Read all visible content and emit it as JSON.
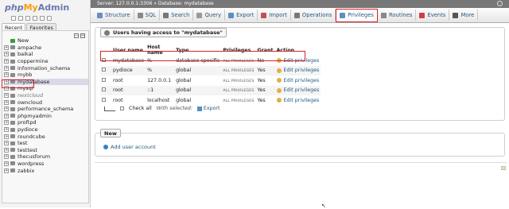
{
  "logo": {
    "php": "php",
    "my": "My",
    "admin": "Admin"
  },
  "nav": {
    "tabs": [
      "Recent",
      "Favorites"
    ],
    "items": [
      {
        "label": "New",
        "type": "new"
      },
      {
        "label": "ampache"
      },
      {
        "label": "baikal"
      },
      {
        "label": "coppermine"
      },
      {
        "label": "information_schema"
      },
      {
        "label": "mybb"
      },
      {
        "label": "mydatabase",
        "selected": true
      },
      {
        "label": "mysql"
      },
      {
        "label": "nextcloud",
        "italic": true
      },
      {
        "label": "owncloud"
      },
      {
        "label": "performance_schema"
      },
      {
        "label": "phpmyadmin"
      },
      {
        "label": "proftpd"
      },
      {
        "label": "pydioce"
      },
      {
        "label": "roundcube"
      },
      {
        "label": "test"
      },
      {
        "label": "testtest"
      },
      {
        "label": "thecusforum"
      },
      {
        "label": "wordpress"
      },
      {
        "label": "zabbix"
      }
    ]
  },
  "breadcrumb": "Server: 127.0.0.1:3306 » Database: mydatabase",
  "menu": [
    {
      "label": "Structure",
      "icon": "structure-icon",
      "color": "#6b8cbe"
    },
    {
      "label": "SQL",
      "icon": "sql-icon",
      "color": "#8a8a8a"
    },
    {
      "label": "Search",
      "icon": "search-icon",
      "color": "#777777"
    },
    {
      "label": "Query",
      "icon": "query-icon",
      "color": "#9a9a9a"
    },
    {
      "label": "Export",
      "icon": "export-icon",
      "color": "#5a8fc0"
    },
    {
      "label": "Import",
      "icon": "import-icon",
      "color": "#c0505a"
    },
    {
      "label": "Operations",
      "icon": "operations-icon",
      "color": "#7a7a7a"
    },
    {
      "label": "Privileges",
      "icon": "privileges-icon",
      "color": "#5a8fc0",
      "active": true
    },
    {
      "label": "Routines",
      "icon": "routines-icon",
      "color": "#888888"
    },
    {
      "label": "Events",
      "icon": "events-icon",
      "color": "#d04040"
    },
    {
      "label": "More",
      "icon": "more-icon",
      "color": "#555555"
    }
  ],
  "users_panel": {
    "legend": "Users having access to \"mydatabase\"",
    "headers": [
      "User name",
      "Host name",
      "Type",
      "Privileges",
      "Grant",
      "Action"
    ],
    "rows": [
      {
        "user": "mydatabase",
        "host": "%",
        "type": "database-specific",
        "privileges": "ALL PRIVILEGES",
        "grant": "No",
        "action": "Edit privileges"
      },
      {
        "user": "pydioce",
        "host": "%",
        "type": "global",
        "privileges": "ALL PRIVILEGES",
        "grant": "Yes",
        "action": "Edit privileges"
      },
      {
        "user": "root",
        "host": "127.0.0.1",
        "type": "global",
        "privileges": "ALL PRIVILEGES",
        "grant": "Yes",
        "action": "Edit privileges"
      },
      {
        "user": "root",
        "host": "::1",
        "type": "global",
        "privileges": "ALL PRIVILEGES",
        "grant": "Yes",
        "action": "Edit privileges"
      },
      {
        "user": "root",
        "host": "localhost",
        "type": "global",
        "privileges": "ALL PRIVILEGES",
        "grant": "Yes",
        "action": "Edit privileges"
      }
    ],
    "check_all": "Check all",
    "with_selected": "With selected:",
    "export": "Export"
  },
  "new_panel": {
    "legend": "New",
    "add_user": "Add user account"
  }
}
